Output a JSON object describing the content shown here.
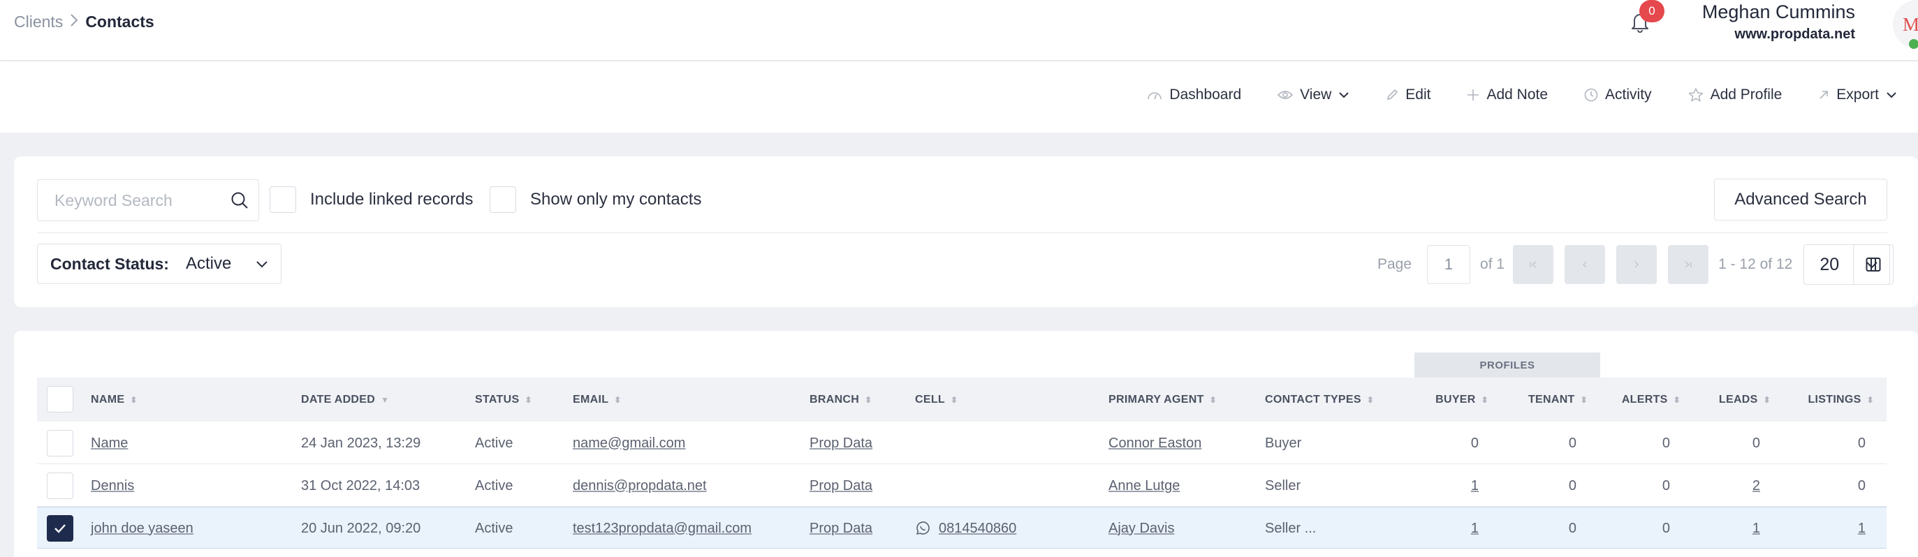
{
  "breadcrumb": {
    "parent": "Clients",
    "current": "Contacts"
  },
  "notifications": {
    "count": "0"
  },
  "user": {
    "name": "Meghan Cummins",
    "site": "www.propdata.net",
    "initials": "MC"
  },
  "actions": [
    {
      "label": "Dashboard",
      "icon": "gauge-icon"
    },
    {
      "label": "View",
      "icon": "eye-icon"
    },
    {
      "label": "Edit",
      "icon": "pencil-icon"
    },
    {
      "label": "Add Note",
      "icon": "plus-icon"
    },
    {
      "label": "Activity",
      "icon": "clock-icon"
    },
    {
      "label": "Add Profile",
      "icon": "star-icon"
    },
    {
      "label": "Export",
      "icon": "arrow-up-right-icon"
    }
  ],
  "filters": {
    "search_placeholder": "Keyword Search",
    "include_linked": "Include linked records",
    "only_mine": "Show only my contacts",
    "advanced": "Advanced Search",
    "status_label": "Contact Status:",
    "status_value": "Active"
  },
  "pagination": {
    "page_label": "Page",
    "page_value": "1",
    "of_label": "of 1",
    "range": "1 - 12 of 12",
    "per_page": "20"
  },
  "table": {
    "group_header": "PROFILES",
    "columns": {
      "name": "NAME",
      "date_added": "DATE ADDED",
      "status": "STATUS",
      "email": "EMAIL",
      "branch": "BRANCH",
      "cell": "CELL",
      "primary_agent": "PRIMARY AGENT",
      "contact_types": "CONTACT TYPES",
      "buyer": "BUYER",
      "tenant": "TENANT",
      "alerts": "ALERTS",
      "leads": "LEADS",
      "listings": "LISTINGS"
    },
    "rows": [
      {
        "name": "Name",
        "date": "24 Jan 2023, 13:29",
        "status": "Active",
        "email": "name@gmail.com",
        "branch": "Prop Data",
        "cell": "",
        "agent": "Connor Easton",
        "types": "Buyer",
        "buyer": "0",
        "tenant": "0",
        "alerts": "0",
        "leads": "0",
        "listings": "0",
        "selected": false
      },
      {
        "name": "Dennis",
        "date": "31 Oct 2022, 14:03",
        "status": "Active",
        "email": "dennis@propdata.net",
        "branch": "Prop Data",
        "cell": "",
        "agent": "Anne Lutge",
        "types": "Seller",
        "buyer": "1",
        "tenant": "0",
        "alerts": "0",
        "leads": "2",
        "listings": "0",
        "selected": false
      },
      {
        "name": "john doe yaseen",
        "date": "20 Jun 2022, 09:20",
        "status": "Active",
        "email": "test123propdata@gmail.com",
        "branch": "Prop Data",
        "cell": "0814540860",
        "agent": "Ajay Davis",
        "types": "Seller ...",
        "buyer": "1",
        "tenant": "0",
        "alerts": "0",
        "leads": "1",
        "listings": "1",
        "selected": true
      }
    ]
  }
}
